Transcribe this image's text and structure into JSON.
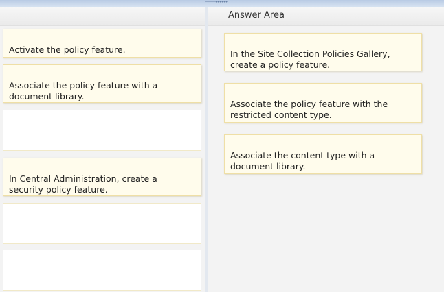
{
  "answer_area": {
    "title": "Answer Area"
  },
  "source_items": [
    {
      "label": "Activate the policy feature."
    },
    {
      "label": "Associate the policy feature with a\ndocument library."
    },
    {
      "label": "In Central Administration, create a\nsecurity policy feature."
    }
  ],
  "answer_items": [
    {
      "label": "In the Site Collection Policies Gallery,\ncreate a policy feature."
    },
    {
      "label": "Associate the policy feature with the\nrestricted content type."
    },
    {
      "label": "Associate the content type with a\ndocument library."
    }
  ]
}
